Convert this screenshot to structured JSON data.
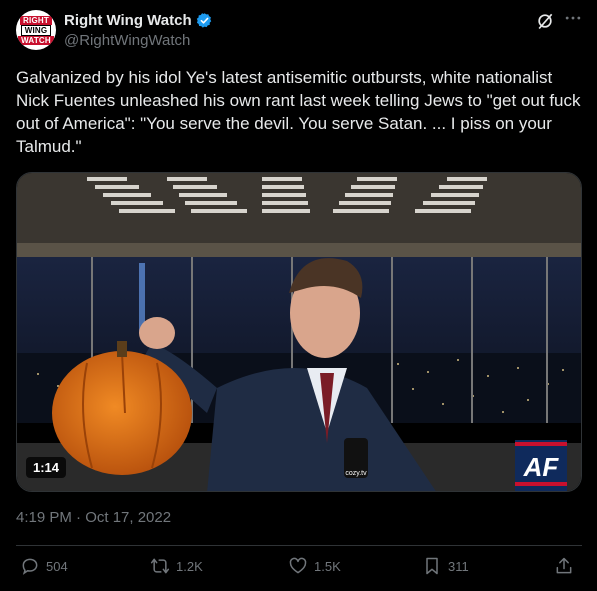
{
  "author": {
    "name": "Right Wing Watch",
    "handle": "@RightWingWatch",
    "avatar_lines": [
      "RIGHT",
      "WING",
      "WATCH"
    ],
    "verified_color": "#1d9bf0"
  },
  "post": {
    "text": "Galvanized by his idol Ye's latest antisemitic outbursts, white nationalist Nick Fuentes unleashed his own rant last week telling Jews to \"get out fuck out of America\": \"You serve the devil. You serve Satan. ... I piss on your Talmud.\"",
    "timestamp": "4:19 PM · Oct 17, 2022"
  },
  "video": {
    "duration": "1:14",
    "watermark": "cozy.tv",
    "logo_text": "AF"
  },
  "actions": {
    "replies": "504",
    "reposts": "1.2K",
    "likes": "1.5K",
    "bookmarks": "311"
  },
  "icons": [
    "verified-badge-icon",
    "grok-icon",
    "more-icon",
    "reply-icon",
    "repost-icon",
    "like-icon",
    "bookmark-icon",
    "share-icon"
  ]
}
